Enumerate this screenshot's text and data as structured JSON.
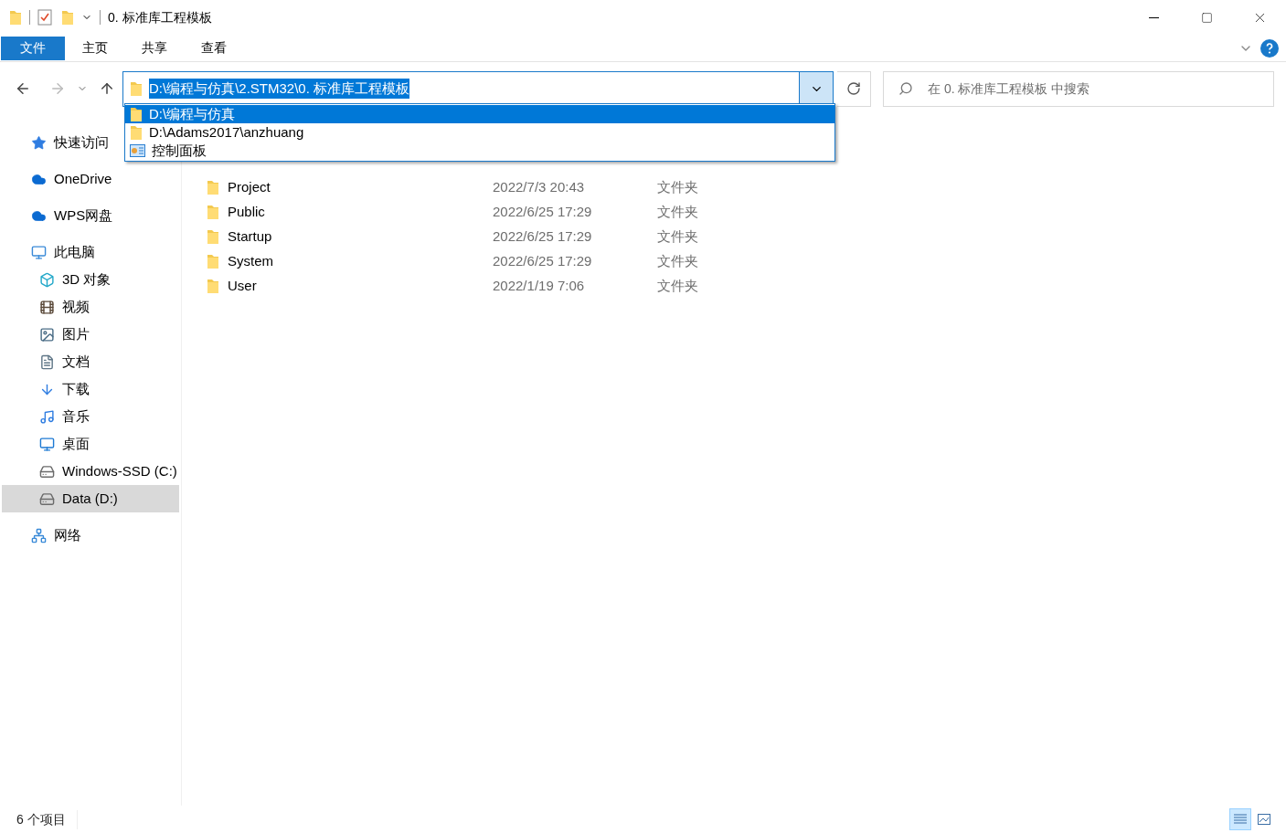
{
  "window": {
    "title": "0. 标准库工程模板"
  },
  "ribbon_tabs": [
    {
      "label": "文件",
      "kind": "file"
    },
    {
      "label": "主页",
      "kind": "tab",
      "selected": false
    },
    {
      "label": "共享",
      "kind": "tab",
      "selected": false
    },
    {
      "label": "查看",
      "kind": "tab",
      "selected": false
    }
  ],
  "address_bar": {
    "value": "D:\\编程与仿真\\2.STM32\\0. 标准库工程模板",
    "highlighted": true
  },
  "address_dropdown": [
    {
      "label": "D:\\编程与仿真",
      "kind": "folder",
      "selected": true
    },
    {
      "label": "D:\\Adams2017\\anzhuang",
      "kind": "folder",
      "selected": false
    },
    {
      "label": "控制面板",
      "kind": "control-panel",
      "selected": false
    }
  ],
  "search": {
    "placeholder": "在 0. 标准库工程模板 中搜索"
  },
  "sidebar": {
    "items": [
      {
        "label": "快速访问",
        "kind": "star",
        "selected": false
      },
      {
        "label": "OneDrive",
        "kind": "cloud",
        "selected": false
      },
      {
        "label": "WPS网盘",
        "kind": "cloud",
        "selected": false
      },
      {
        "label": "此电脑",
        "kind": "pc",
        "selected": false,
        "children": [
          {
            "label": "3D 对象",
            "kind": "cube",
            "selected": false
          },
          {
            "label": "视频",
            "kind": "film",
            "selected": false
          },
          {
            "label": "图片",
            "kind": "picture",
            "selected": false
          },
          {
            "label": "文档",
            "kind": "document",
            "selected": false
          },
          {
            "label": "下载",
            "kind": "download",
            "selected": false
          },
          {
            "label": "音乐",
            "kind": "music",
            "selected": false
          },
          {
            "label": "桌面",
            "kind": "desktop",
            "selected": false
          },
          {
            "label": "Windows-SSD (C:)",
            "kind": "drive",
            "selected": false
          },
          {
            "label": "Data (D:)",
            "kind": "drive",
            "selected": true
          }
        ]
      },
      {
        "label": "网络",
        "kind": "network",
        "selected": false
      }
    ]
  },
  "files": [
    {
      "name": "Project",
      "modified": "2022/7/3 20:43",
      "type": "文件夹"
    },
    {
      "name": "Public",
      "modified": "2022/6/25 17:29",
      "type": "文件夹"
    },
    {
      "name": "Startup",
      "modified": "2022/6/25 17:29",
      "type": "文件夹"
    },
    {
      "name": "System",
      "modified": "2022/6/25 17:29",
      "type": "文件夹"
    },
    {
      "name": "User",
      "modified": "2022/1/19 7:06",
      "type": "文件夹"
    }
  ],
  "status_bar": {
    "item_count": "6 个项目",
    "view_buttons": [
      {
        "selected": true
      },
      {
        "selected": false
      }
    ]
  }
}
